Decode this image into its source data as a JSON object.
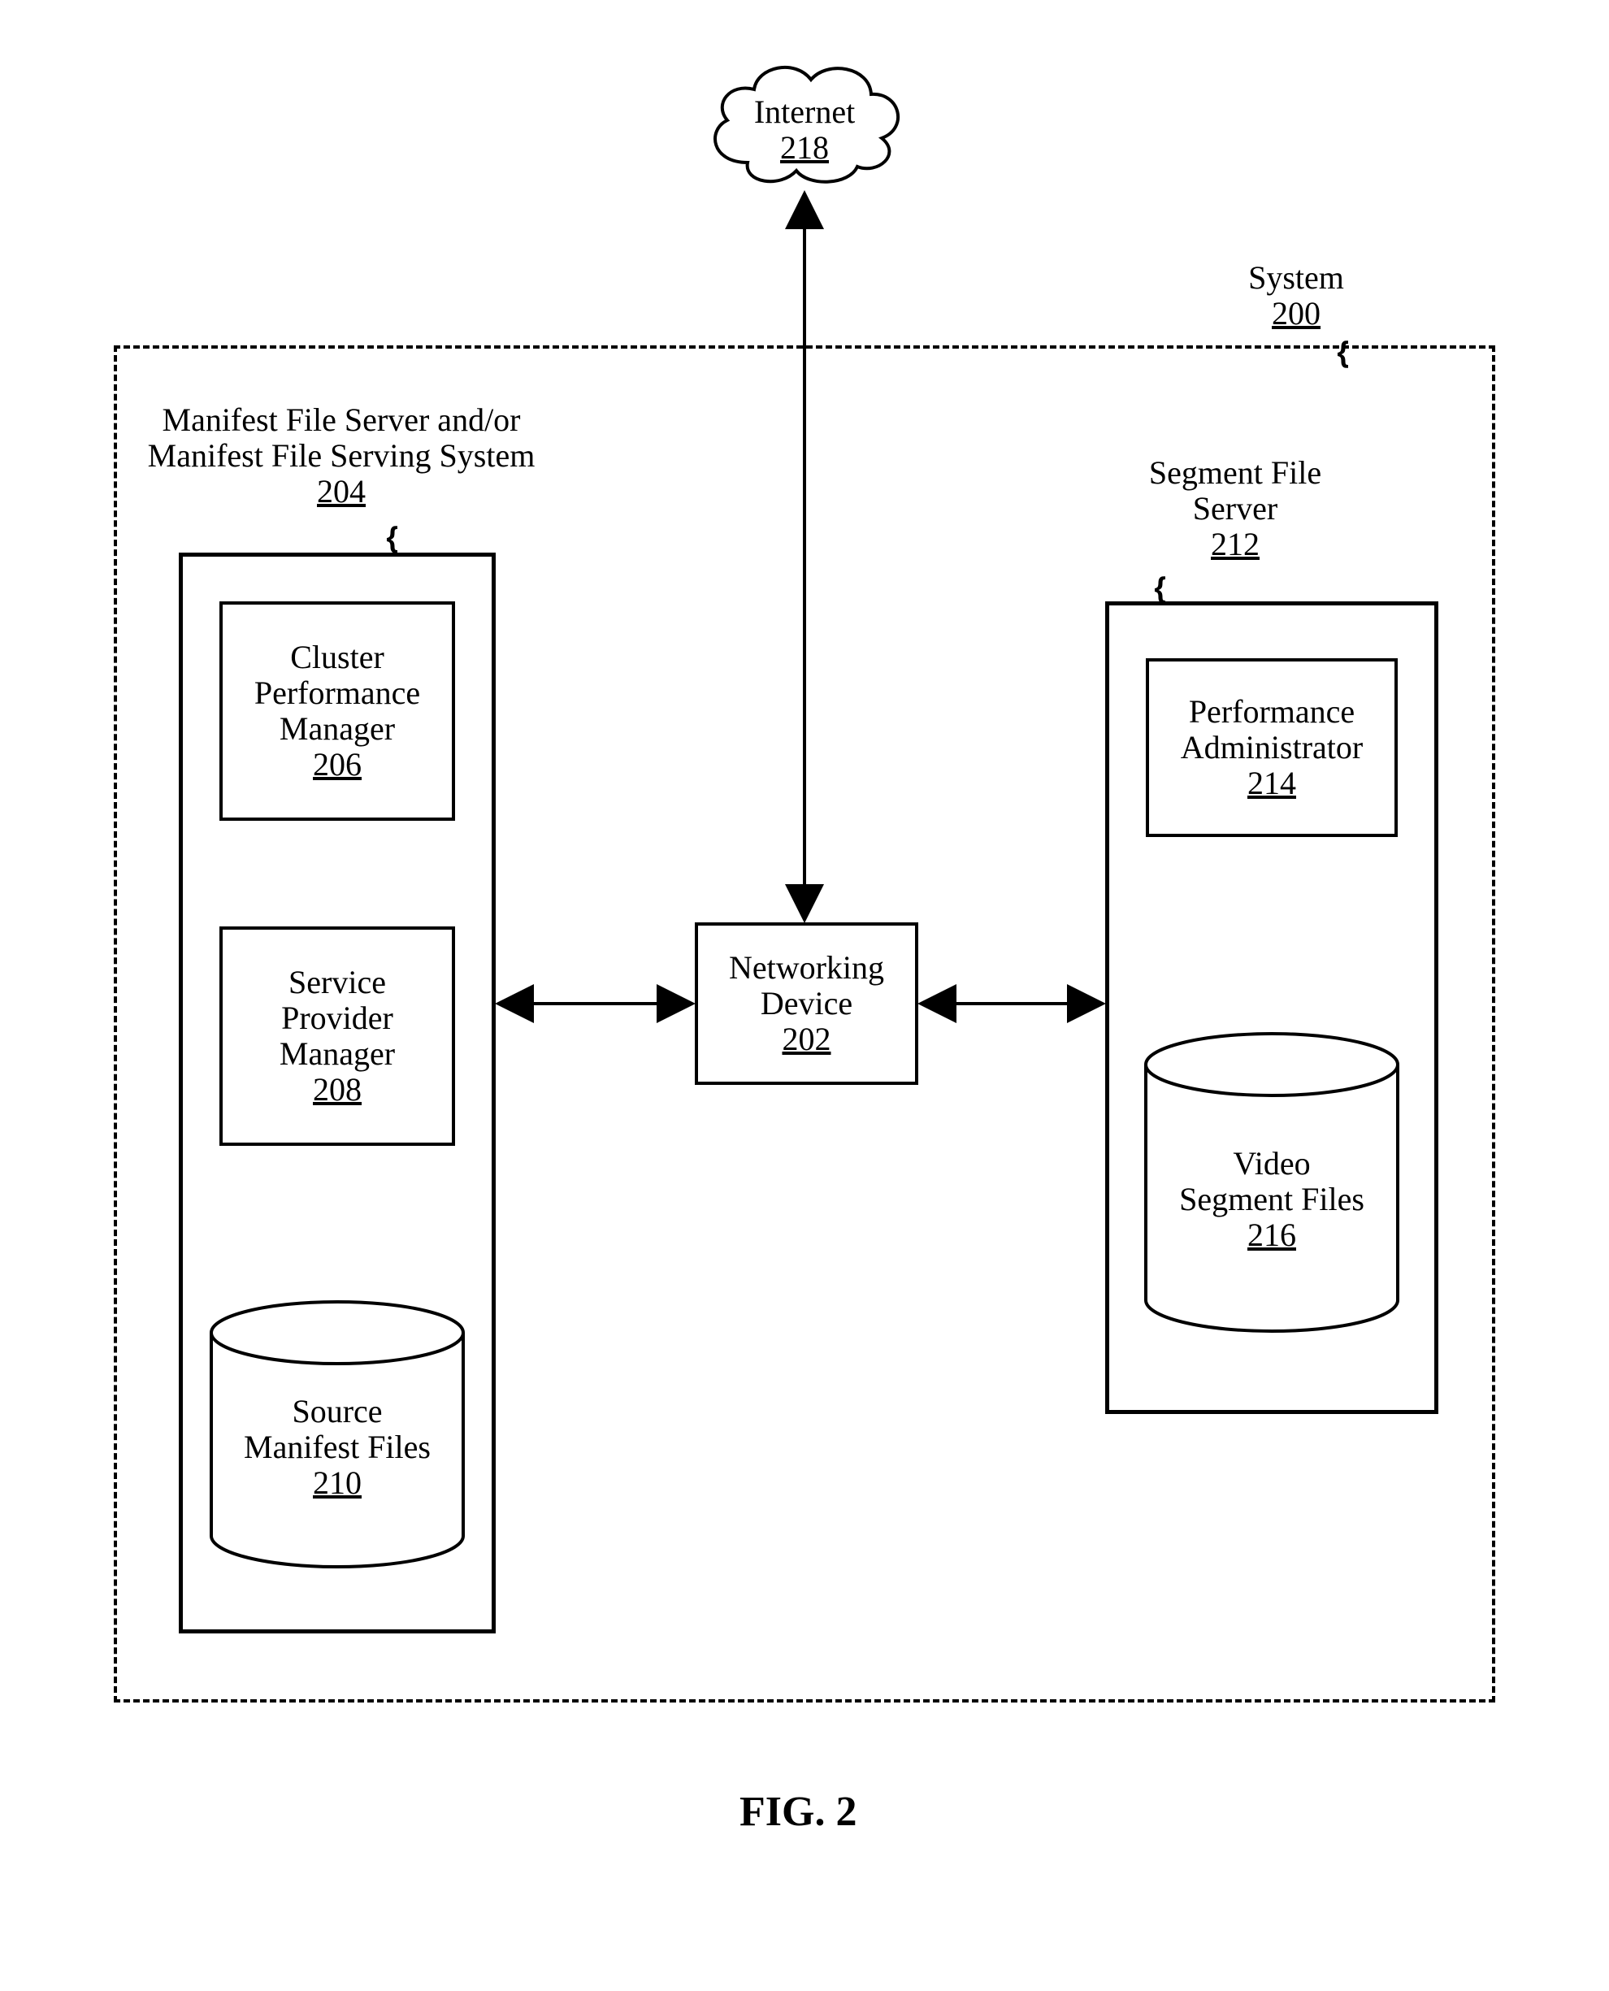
{
  "cloud": {
    "line1": "Internet",
    "line2": "218"
  },
  "system_label": {
    "line1": "System",
    "line2": "200"
  },
  "manifest_server": {
    "title_line1": "Manifest File Server and/or",
    "title_line2": "Manifest File Serving System",
    "title_ref": "204",
    "cluster_box": {
      "line1": "Cluster",
      "line2": "Performance",
      "line3": "Manager",
      "ref": "206"
    },
    "service_box": {
      "line1": "Service",
      "line2": "Provider",
      "line3": "Manager",
      "ref": "208"
    },
    "source_cyl": {
      "line1": "Source",
      "line2": "Manifest Files",
      "ref": "210"
    }
  },
  "networking_device": {
    "line1": "Networking",
    "line2": "Device",
    "ref": "202"
  },
  "segment_server": {
    "title_line1": "Segment File",
    "title_line2": "Server",
    "title_ref": "212",
    "perf_box": {
      "line1": "Performance",
      "line2": "Administrator",
      "ref": "214"
    },
    "video_cyl": {
      "line1": "Video",
      "line2": "Segment Files",
      "ref": "216"
    }
  },
  "figure_caption": "FIG. 2"
}
